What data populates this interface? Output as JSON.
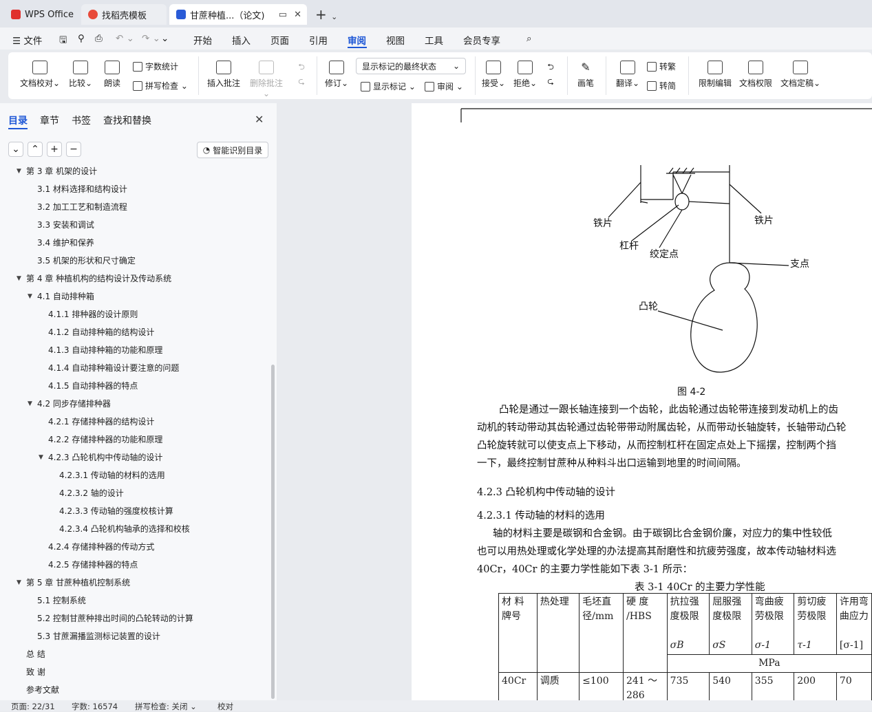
{
  "tabs": {
    "wps": "WPS Office",
    "template": "找稻壳模板",
    "document": "甘蔗种植...（论文)"
  },
  "menubar": {
    "file": "文件",
    "items": [
      "开始",
      "插入",
      "页面",
      "引用",
      "审阅",
      "视图",
      "工具",
      "会员专享"
    ],
    "active": "审阅"
  },
  "ribbon": {
    "doc_proofread": "文档校对",
    "compare": "比较",
    "read_aloud": "朗读",
    "word_count": "字数统计",
    "spell_check": "拼写检查",
    "insert_comment": "插入批注",
    "delete_comment": "删除批注",
    "track_changes": "修订",
    "markup_state": "显示标记的最终状态",
    "show_markup": "显示标记",
    "review": "审阅",
    "accept": "接受",
    "reject": "拒绝",
    "pen": "画笔",
    "translate": "翻译",
    "to_traditional": "转繁",
    "to_simplified": "转简",
    "restrict_edit": "限制编辑",
    "doc_permission": "文档权限",
    "finalize": "文档定稿"
  },
  "nav": {
    "tabs": [
      "目录",
      "章节",
      "书签",
      "查找和替换"
    ],
    "smart_toc": "智能识别目录",
    "toc": [
      "第 3 章  机架的设计",
      "3.1 材料选择和结构设计",
      "3.2 加工工艺和制造流程",
      "3.3 安装和调试",
      "3.4 维护和保养",
      "3.5  机架的形状和尺寸确定",
      "第 4 章  种植机构的结构设计及传动系统",
      "4.1 自动排种箱",
      "4.1.1 排种器的设计原则",
      "4.1.2 自动排种箱的结构设计",
      "4.1.3 自动排种箱的功能和原理",
      "4.1.4 自动排种箱设计要注意的问题",
      "4.1.5 自动排种器的特点",
      "4.2 同步存储排种器",
      "4.2.1 存储排种器的结构设计",
      "4.2.2 存储排种器的功能和原理",
      "4.2.3 凸轮机构中传动轴的设计",
      "4.2.3.1 传动轴的材料的选用",
      "4.2.3.2 轴的设计",
      "4.2.3.3  传动轴的强度校核计算",
      "4.2.3.4 凸轮机构轴承的选择和校核",
      "4.2.4 存储排种器的传动方式",
      "4.2.5 存储排种器的特点",
      "第 5 章  甘蔗种植机控制系统",
      "5.1 控制系统",
      "5.2 控制甘蔗种排出时间的凸轮转动的计算",
      "5.3 甘蔗漏播监测标记装置的设计",
      "总   结",
      "致   谢",
      "参考文献"
    ]
  },
  "document": {
    "figure_labels": {
      "plate_left": "铁片",
      "plate_right": "铁片",
      "lever": "杠杆",
      "hinge": "绞定点",
      "fulcrum": "支点",
      "cam": "凸轮"
    },
    "figure_caption": "图 4-2",
    "para1": [
      "凸轮是通过一跟长轴连接到一个齿轮，此齿轮通过齿轮带连接到发动机上的齿",
      "动机的转动带动其齿轮通过齿轮带带动附属齿轮，从而带动长轴旋转，长轴带动凸轮",
      "凸轮旋转就可以使支点上下移动，从而控制杠杆在固定点处上下摇摆，控制两个挡",
      "一下，最终控制甘蔗种从种料斗出口运输到地里的时间间隔。"
    ],
    "heading1": "4.2.3 凸轮机构中传动轴的设计",
    "heading2": "4.2.3.1 传动轴的材料的选用",
    "para2": [
      "轴的材料主要是碳钢和合金钢。由于碳钢比合金钢价廉，对应力的集中性较低",
      "也可以用热处理或化学处理的办法提高其耐磨性和抗疲劳强度，故本传动轴材料选",
      "40Cr，40Cr 的主要力学性能如下表 3-1 所示："
    ],
    "table_caption": "表 3-1 40Cr 的主要力学性能",
    "table": {
      "h_material": [
        "材 料",
        "牌号"
      ],
      "h_heat": "热处理",
      "h_blank": [
        "毛坯直",
        "径/mm"
      ],
      "h_hard": [
        "硬    度",
        "/HBS"
      ],
      "h_tensile": [
        "抗拉强",
        "度极限"
      ],
      "h_yield": [
        "屈服强",
        "度极限"
      ],
      "h_bend": [
        "弯曲疲",
        "劳极限"
      ],
      "h_shear": [
        "剪切疲",
        "劳极限"
      ],
      "h_allow": [
        "许用弯",
        "曲应力"
      ],
      "sym_tensile": "σB",
      "sym_yield": "σS",
      "sym_bend": "σ-1",
      "sym_shear": "τ-1",
      "sym_allow": "[σ-1]",
      "unit": "MPa",
      "row": {
        "material": "40Cr",
        "heat": "调质",
        "blank": "≤100",
        "hard": [
          "241 ～",
          "286"
        ],
        "tensile": "735",
        "yield": "540",
        "bend": "355",
        "shear": "200",
        "allow": "70"
      }
    }
  },
  "status": {
    "page": "页面: 22/31",
    "words": "字数: 16574",
    "spell": "拼写检查: 关闭",
    "proof": "校对"
  },
  "colors": {
    "accent": "#1e57d6",
    "wps_red": "#e0302d",
    "doc_blue": "#2a5bd7"
  }
}
